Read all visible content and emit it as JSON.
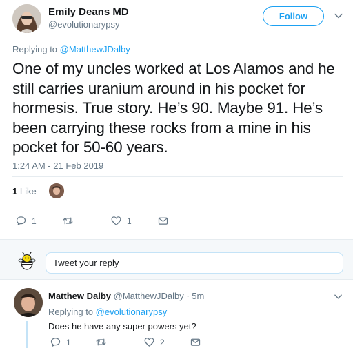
{
  "tweet": {
    "author_name": "Emily Deans MD",
    "author_handle": "@evolutionarypsy",
    "follow_label": "Follow",
    "replying_prefix": "Replying to",
    "replying_handle": "@MatthewJDalby",
    "text": "One of my uncles worked at Los Alamos and he still carries uranium around in his pocket for hormesis. True story. He’s 90. Maybe 91. He’s been carrying these rocks from a mine in his pocket for 50-60 years.",
    "timestamp": "1:24 AM - 21 Feb 2019",
    "like_count": "1",
    "like_label": "Like",
    "actions": {
      "reply_count": "1",
      "retweet_count": "",
      "like_count": "1"
    }
  },
  "composer": {
    "placeholder": "Tweet your reply"
  },
  "reply": {
    "author_name": "Matthew Dalby",
    "author_handle": "@MatthewJDalby",
    "time": "· 5m",
    "replying_prefix": "Replying to",
    "replying_handle": "@evolutionarypsy",
    "text": "Does he have any super powers yet?",
    "actions": {
      "reply_count": "1",
      "retweet_count": "",
      "like_count": "2"
    }
  },
  "colors": {
    "accent": "#1da1f2",
    "secondary_text": "#657786",
    "primary_text": "#14171a",
    "divider": "#e6ecf0"
  }
}
